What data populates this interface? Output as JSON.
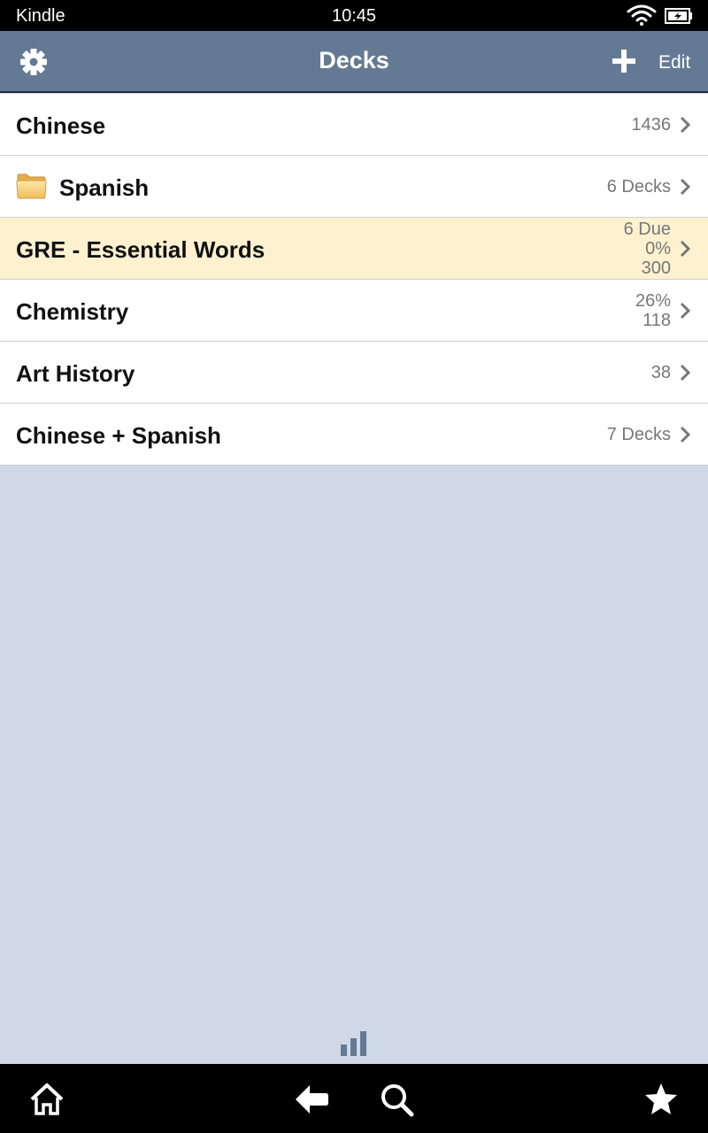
{
  "status_bar": {
    "carrier": "Kindle",
    "time": "10:45"
  },
  "nav": {
    "title": "Decks",
    "edit_label": "Edit"
  },
  "decks": [
    {
      "name": "Chinese",
      "meta": [
        "1436"
      ],
      "folder": false,
      "highlight": false
    },
    {
      "name": "Spanish",
      "meta": [
        "6 Decks"
      ],
      "folder": true,
      "highlight": false
    },
    {
      "name": "GRE - Essential Words",
      "meta": [
        "6 Due",
        "0%",
        "300"
      ],
      "folder": false,
      "highlight": true
    },
    {
      "name": "Chemistry",
      "meta": [
        "26%",
        "118"
      ],
      "folder": false,
      "highlight": false
    },
    {
      "name": "Art History",
      "meta": [
        "38"
      ],
      "folder": false,
      "highlight": false
    },
    {
      "name": "Chinese + Spanish",
      "meta": [
        "7 Decks"
      ],
      "folder": false,
      "highlight": false
    }
  ],
  "icons": {
    "settings": "gear-icon",
    "add": "plus-icon",
    "sync": "bar-chart-icon",
    "home": "home-icon",
    "back": "back-arrow-icon",
    "search": "search-icon",
    "favorites": "star-icon"
  },
  "colors": {
    "nav_bar": "#647a94",
    "highlight_row": "#fdf1cf",
    "background": "#cfd9e6"
  }
}
